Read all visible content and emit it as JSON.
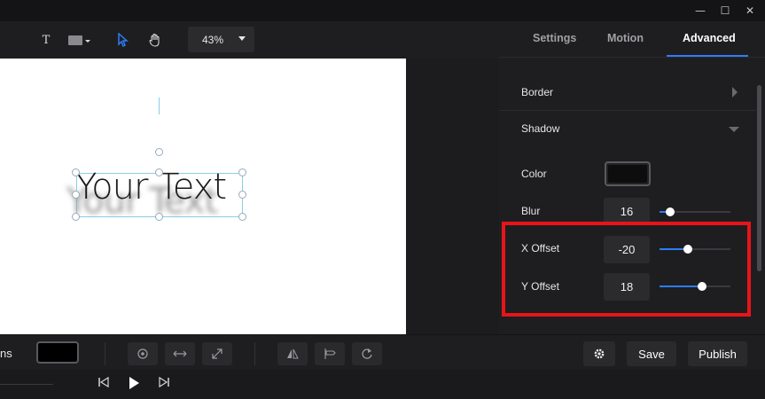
{
  "window": {
    "minimize": "—",
    "maximize": "☐",
    "close": "✕"
  },
  "toolbar": {
    "text_tool": "T",
    "zoom_value": "43%"
  },
  "canvas": {
    "text": "Your Text"
  },
  "panel": {
    "tabs": [
      {
        "label": "Settings"
      },
      {
        "label": "Motion"
      },
      {
        "label": "Advanced"
      }
    ],
    "active_tab": "Advanced",
    "sections": {
      "border": {
        "label": "Border"
      },
      "shadow": {
        "label": "Shadow"
      }
    },
    "shadow": {
      "color_label": "Color",
      "color_value": "#0d0d0e",
      "blur_label": "Blur",
      "blur_value": "16",
      "blur_slider_fraction": 0.15,
      "x_offset_label": "X Offset",
      "x_offset_value": "-20",
      "x_offset_slider_fraction": 0.4,
      "y_offset_label": "Y Offset",
      "y_offset_value": "18",
      "y_offset_slider_fraction": 0.6
    }
  },
  "bottombar": {
    "left_label": "ns",
    "save_label": "Save",
    "publish_label": "Publish"
  },
  "colors": {
    "accent": "#2d7cf6",
    "highlight": "#e8141a"
  }
}
